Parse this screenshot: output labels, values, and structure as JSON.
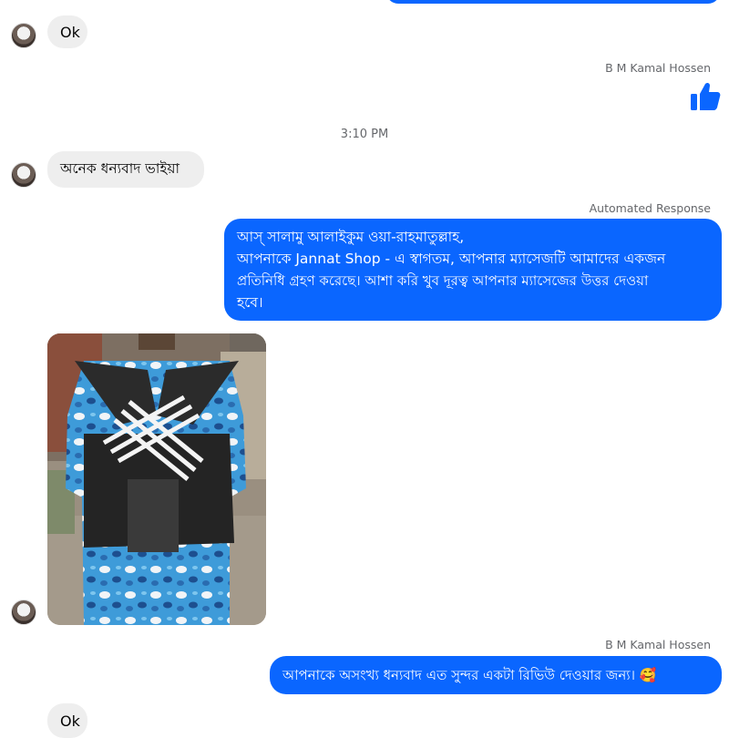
{
  "conversation": {
    "messages": {
      "msg_ok_1": "Ok",
      "sender_1": "B M Kamal Hossen",
      "timestamp": "3:10 PM",
      "msg_thanks_brother": "অনেক ধন্যবাদ ভাইয়া",
      "automated_label": "Automated Response",
      "auto_reply_lines": [
        "আস্ সালামু আলাইকুম ওয়া-রাহমাতুল্লাহ,",
        "আপনাকে Jannat Shop - এ স্বাগতম, আপনার ম্যাসেজটি আমাদের একজন",
        "প্রতিনিধি গ্রহণ করেছে। আশা করি খুব দূরত্ব আপনার ম্যাসেজের উত্তর দেওয়া",
        "হবে।"
      ],
      "sender_2": "B M Kamal Hossen",
      "thanks_reply": "আপনাকে অসংখ্য ধন্যবাদ এত সুন্দর একটা রিভিউ দেওয়ার জন্য। 🥰",
      "msg_ok_2": "Ok"
    }
  },
  "colors": {
    "outgoing_bubble": "#0a66ff",
    "incoming_bubble": "#eeeeee",
    "meta_text": "#65676b"
  },
  "icons": {
    "like": "thumbs-up-icon",
    "avatar": "contact-avatar"
  }
}
